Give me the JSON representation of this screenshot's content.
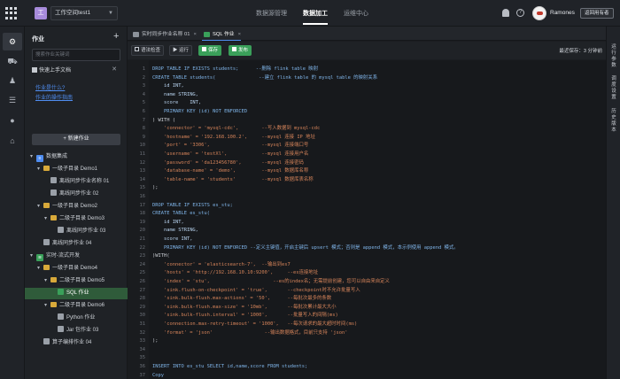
{
  "header": {
    "workspace_logo": "工",
    "workspace_name": "工作空间test1",
    "nav": [
      {
        "label": "数据源管理",
        "active": false
      },
      {
        "label": "数据加工",
        "active": true
      },
      {
        "label": "运维中心",
        "active": false
      }
    ],
    "username": "Ramones",
    "back_label": "返回用有者"
  },
  "rail_icons": [
    "gear-icon",
    "bus-icon",
    "person-icon",
    "list-icon",
    "pulse-icon",
    "cart-icon"
  ],
  "sidebar": {
    "title": "作业",
    "search_placeholder": "搜索作业关键词",
    "quick_panel": "快速上手文档",
    "links": [
      "作业是什么?",
      "作业的操作指南"
    ],
    "new_job": "+ 新建作业",
    "tree": [
      {
        "label": "数据集成",
        "level": 0,
        "type": "module",
        "expanded": true
      },
      {
        "label": "一级子目录 Demo1",
        "level": 1,
        "type": "folder",
        "expanded": true
      },
      {
        "label": "离线同步作业名称 01",
        "level": 2,
        "type": "job"
      },
      {
        "label": "离线同步作业 02",
        "level": 2,
        "type": "job"
      },
      {
        "label": "一级子目录 Demo2",
        "level": 1,
        "type": "folder",
        "expanded": true
      },
      {
        "label": "二级子目录 Demo3",
        "level": 2,
        "type": "folder",
        "expanded": true
      },
      {
        "label": "离线同步作业 03",
        "level": 3,
        "type": "job"
      },
      {
        "label": "离线同步作业 04",
        "level": 1,
        "type": "job"
      },
      {
        "label": "实时-流式开发",
        "level": 0,
        "type": "module",
        "expanded": true
      },
      {
        "label": "一级子目录 Demo4",
        "level": 1,
        "type": "folder",
        "expanded": true
      },
      {
        "label": "二级子目录 Demo5",
        "level": 2,
        "type": "folder",
        "expanded": true
      },
      {
        "label": "SQL 作业",
        "level": 3,
        "type": "sql",
        "selected": true
      },
      {
        "label": "二级子目录 Demo6",
        "level": 2,
        "type": "folder",
        "expanded": true
      },
      {
        "label": "Python 作业",
        "level": 3,
        "type": "job"
      },
      {
        "label": "Jar 包作业 03",
        "level": 3,
        "type": "job"
      },
      {
        "label": "算子编排作业 04",
        "level": 1,
        "type": "job"
      }
    ]
  },
  "tabs": [
    {
      "label": "实时同步作业名称 01",
      "active": false
    },
    {
      "label": "SQL 作业",
      "active": true
    }
  ],
  "toolbar": {
    "buttons": [
      "语法检查",
      "运行",
      "保存",
      "发布"
    ],
    "autosave": "最近保存：3 分钟前"
  },
  "right_rail": [
    "运行参数",
    "调度设置",
    "历史版本"
  ],
  "code": [
    {
      "ln": "1",
      "text": "DROP TABLE IF EXISTS students;      --删除 flink table 映射",
      "style": "kw"
    },
    {
      "ln": "2",
      "text": "CREATE TABLE students(               --建立 flink table 的 mysql table 的映射关系",
      "style": "kw"
    },
    {
      "ln": "3",
      "text": "    id INT,",
      "style": "fld"
    },
    {
      "ln": "4",
      "text": "    name STRING,",
      "style": "fld"
    },
    {
      "ln": "5",
      "text": "    score    INT,",
      "style": "fld"
    },
    {
      "ln": "6",
      "text": "    PRIMARY KEY (id) NOT ENFORCED",
      "style": "kw"
    },
    {
      "ln": "7",
      "text": ") WITH (",
      "style": "plain"
    },
    {
      "ln": "8",
      "text": "    'connector' = 'mysql-cdc',        --写入数据到 mysql-cdc",
      "style": "str"
    },
    {
      "ln": "9",
      "text": "    'hostname' = '192.168.100.2',     --mysql 连接 IP 地址",
      "style": "str"
    },
    {
      "ln": "10",
      "text": "    'port' = '3306',                  --mysql 连接端口号",
      "style": "str"
    },
    {
      "ln": "11",
      "text": "    'username' = 'testXl',            --mysql 连接用户名",
      "style": "str"
    },
    {
      "ln": "12",
      "text": "    'password' = 'da123456780',       --mysql 连接密码",
      "style": "str"
    },
    {
      "ln": "13",
      "text": "    'database-name' = 'demo',         --mysql 数据库名称",
      "style": "str"
    },
    {
      "ln": "14",
      "text": "    'table-name' = 'students'         --mysql 数据库表名称",
      "style": "str"
    },
    {
      "ln": "15",
      "text": ");",
      "style": "plain"
    },
    {
      "ln": "16",
      "text": "",
      "style": "plain"
    },
    {
      "ln": "17",
      "text": "DROP TABLE IF EXISTS es_stu;",
      "style": "kw"
    },
    {
      "ln": "18",
      "text": "CREATE TABLE es_stu(",
      "style": "kw"
    },
    {
      "ln": "19",
      "text": "    id INT,",
      "style": "fld"
    },
    {
      "ln": "20",
      "text": "    name STRING,",
      "style": "fld"
    },
    {
      "ln": "21",
      "text": "    score INT,",
      "style": "fld"
    },
    {
      "ln": "22",
      "text": "    PRIMARY KEY (id) NOT ENFORCED --定义主键值，开启主键后 upsert 模式；否则是 append 模式，本示例使用 append 模式。",
      "style": "kw"
    },
    {
      "ln": "23",
      "text": ")WITH(",
      "style": "plain"
    },
    {
      "ln": "24",
      "text": "    'connector' = 'elasticsearch-7',  --输出到es7",
      "style": "str"
    },
    {
      "ln": "25",
      "text": "    'hosts' = 'http://192.168.10.10:9200',     --es连接地址",
      "style": "str"
    },
    {
      "ln": "26",
      "text": "    'index' = 'stu',                      --es的index名；无需提前创建，您可以自由来自定义",
      "style": "str"
    },
    {
      "ln": "27",
      "text": "    'sink.flush-on-checkpoint' = 'true',       --checkpoint时不允许批量写入",
      "style": "str"
    },
    {
      "ln": "28",
      "text": "    'sink.bulk-flush.max-actions' = '50',      --每批次最多的条数",
      "style": "str"
    },
    {
      "ln": "29",
      "text": "    'sink.bulk-flush.max-size' = '10mb',       --每批次累计最大大小",
      "style": "str"
    },
    {
      "ln": "30",
      "text": "    'sink.bulk-flush.interval' = '1000',       --批量写入的间隔(ms)",
      "style": "str"
    },
    {
      "ln": "31",
      "text": "    'connection.max-retry-timeout' = '1000',   --每次请求的最大超时时间(ms)",
      "style": "str"
    },
    {
      "ln": "32",
      "text": "    'format' = 'json'                  --输出数据格式，目前只支持 'json'",
      "style": "str"
    },
    {
      "ln": "33",
      "text": ");",
      "style": "plain"
    },
    {
      "ln": "34",
      "text": "",
      "style": "plain"
    },
    {
      "ln": "35",
      "text": "",
      "style": "plain"
    },
    {
      "ln": "36",
      "text": "INSERT INTO es_stu SELECT id,name,score FROM students;",
      "style": "kw"
    },
    {
      "ln": "37",
      "text": "Copy",
      "style": "kw"
    }
  ],
  "colors": {
    "accent_blue": "#4f8df0",
    "accent_green": "#3aa05a",
    "folder": "#d8a93a"
  }
}
